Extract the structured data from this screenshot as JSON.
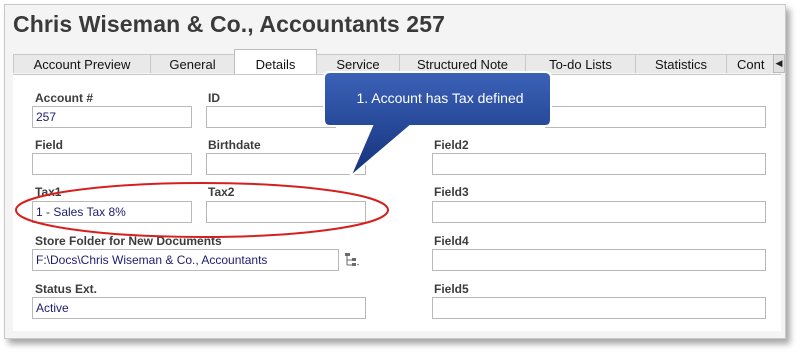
{
  "window": {
    "title": "Chris Wiseman & Co., Accountants 257"
  },
  "tabs": [
    {
      "label": "Account Preview",
      "active": false
    },
    {
      "label": "General",
      "active": false
    },
    {
      "label": "Details",
      "active": true
    },
    {
      "label": "Service",
      "active": false
    },
    {
      "label": "Structured Note",
      "active": false
    },
    {
      "label": "To-do Lists",
      "active": false
    },
    {
      "label": "Statistics",
      "active": false
    },
    {
      "label": "Cont",
      "active": false
    }
  ],
  "tab_scroll_icon": "chevron-left-icon",
  "fields": {
    "account_number": {
      "label": "Account #",
      "value": "257"
    },
    "id": {
      "label": "ID",
      "value": ""
    },
    "field": {
      "label": "Field",
      "value": ""
    },
    "birthdate": {
      "label": "Birthdate",
      "value": ""
    },
    "tax1": {
      "label": "Tax1",
      "value": "1 - Sales Tax 8%"
    },
    "tax2": {
      "label": "Tax2",
      "value": ""
    },
    "store_folder": {
      "label": "Store Folder for New Documents",
      "value": "F:\\Docs\\Chris Wiseman & Co., Accountants"
    },
    "status_ext": {
      "label": "Status Ext.",
      "value": "Active"
    },
    "field1": {
      "value": ""
    },
    "field2": {
      "label": "Field2",
      "value": ""
    },
    "field3": {
      "label": "Field3",
      "value": ""
    },
    "field4": {
      "label": "Field4",
      "value": ""
    },
    "field5": {
      "label": "Field5",
      "value": ""
    }
  },
  "folder_icon": "folder-tree-icon",
  "annotation": {
    "callout_text": "1. Account has Tax defined",
    "callout_color": "#1b3f8e",
    "highlight_color": "#d62020"
  }
}
